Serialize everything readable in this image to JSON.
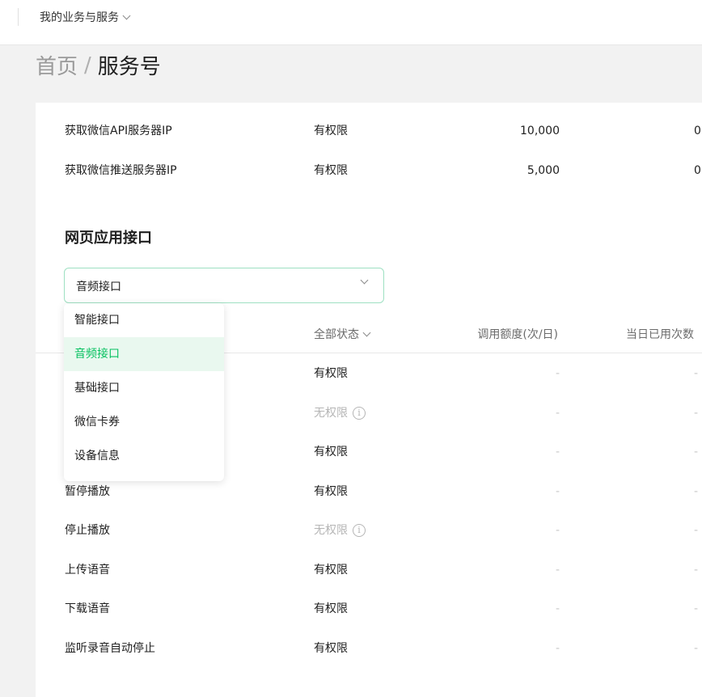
{
  "topbar": {
    "menu_label": "我的业务与服务"
  },
  "breadcrumb": {
    "home": "首页",
    "separator": "/",
    "current": "服务号"
  },
  "prev_rows": [
    {
      "name": "获取微信API服务器IP",
      "status": "有权限",
      "quota": "10,000",
      "used": "0"
    },
    {
      "name": "获取微信推送服务器IP",
      "status": "有权限",
      "quota": "5,000",
      "used": "0"
    }
  ],
  "section": {
    "title": "网页应用接口"
  },
  "select": {
    "value": "音频接口"
  },
  "dropdown": {
    "options": [
      "智能接口",
      "音频接口",
      "基础接口",
      "微信卡券",
      "设备信息"
    ],
    "selected": "音频接口"
  },
  "table": {
    "headers": {
      "status": "全部状态",
      "quota": "调用额度(次/日)",
      "used": "当日已用次数"
    },
    "rows": [
      {
        "name": "",
        "status": "有权限",
        "has_info": false,
        "quota": "-",
        "used": "-"
      },
      {
        "name": "",
        "status": "无权限",
        "has_info": true,
        "quota": "-",
        "used": "-"
      },
      {
        "name": "",
        "status": "有权限",
        "has_info": false,
        "quota": "-",
        "used": "-"
      },
      {
        "name": "暂停播放",
        "status": "有权限",
        "has_info": false,
        "quota": "-",
        "used": "-"
      },
      {
        "name": "停止播放",
        "status": "无权限",
        "has_info": true,
        "quota": "-",
        "used": "-"
      },
      {
        "name": "上传语音",
        "status": "有权限",
        "has_info": false,
        "quota": "-",
        "used": "-"
      },
      {
        "name": "下载语音",
        "status": "有权限",
        "has_info": false,
        "quota": "-",
        "used": "-"
      },
      {
        "name": "监听录音自动停止",
        "status": "有权限",
        "has_info": false,
        "quota": "-",
        "used": "-"
      }
    ]
  },
  "colors": {
    "accent": "#07c160",
    "accent_bg": "#e9f8ef",
    "select_border": "#9ee0c2"
  },
  "icons": {
    "info": "info-circle-icon",
    "chevron": "chevron-down-icon"
  }
}
